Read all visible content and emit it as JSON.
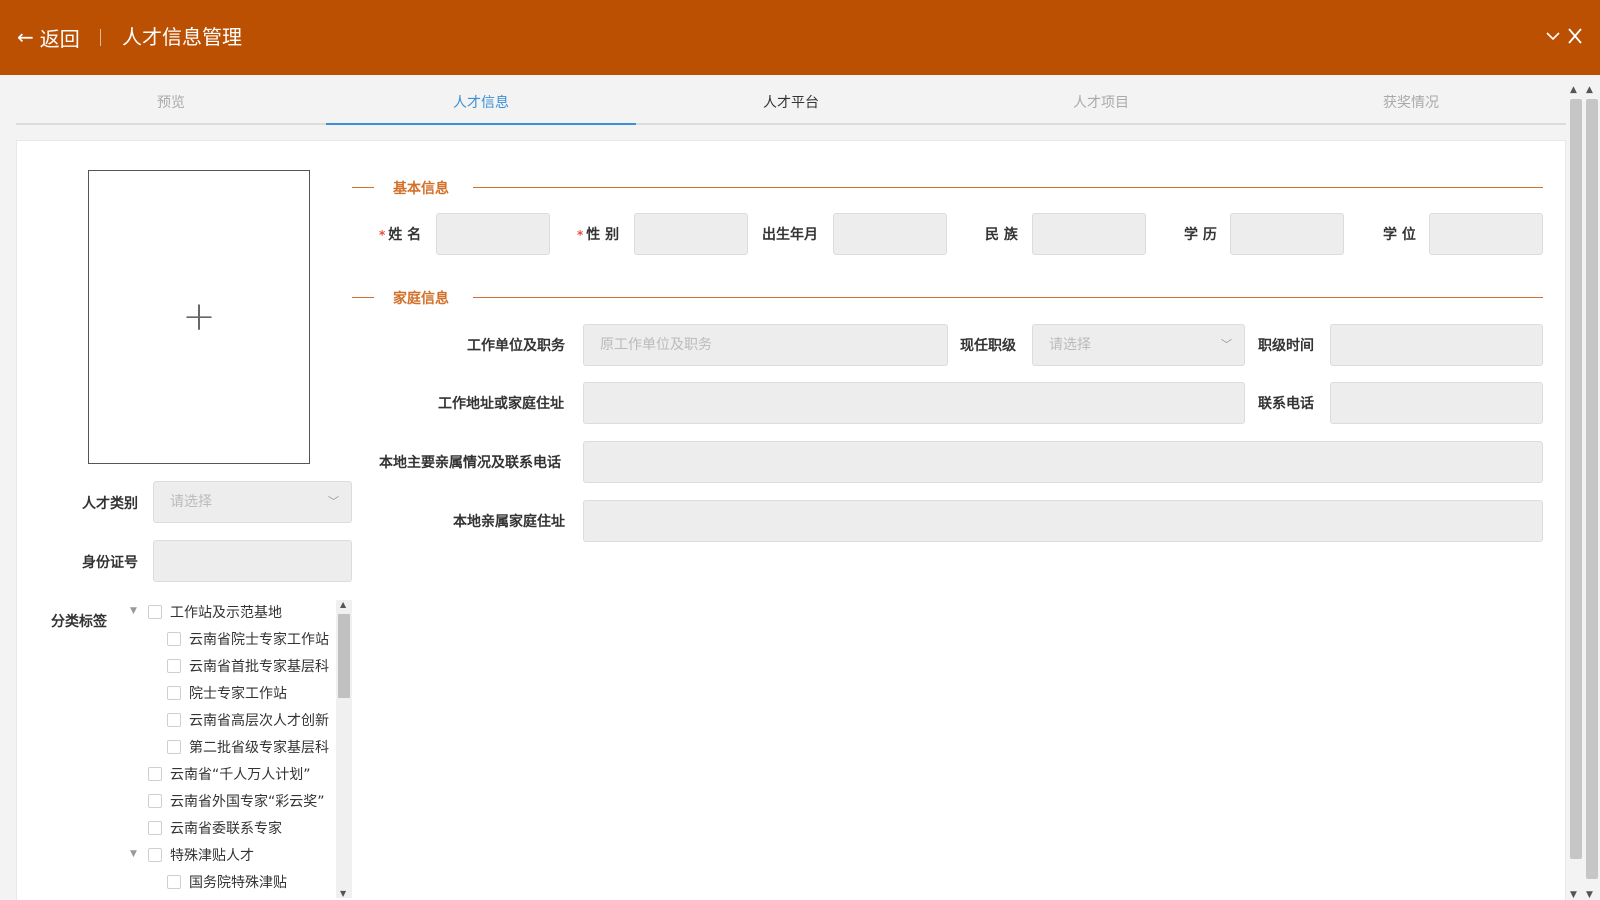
{
  "header": {
    "back_label": "返回",
    "title": "人才信息管理",
    "bg_color": "#bb5003"
  },
  "tabs": [
    {
      "label": "预览",
      "state": "disabled"
    },
    {
      "label": "人才信息",
      "state": "active"
    },
    {
      "label": "人才平台",
      "state": "normal"
    },
    {
      "label": "人才项目",
      "state": "disabled"
    },
    {
      "label": "获奖情况",
      "state": "disabled"
    }
  ],
  "left_panel": {
    "talent_category_label": "人才类别",
    "talent_category_placeholder": "请选择",
    "id_number_label": "身份证号",
    "tag_label": "分类标签"
  },
  "basic_info": {
    "title": "基本信息",
    "name_label": "姓 名",
    "gender_label": "性 别",
    "birth_label": "出生年月",
    "ethnicity_label": "民 族",
    "education_label": "学 历",
    "degree_label": "学 位",
    "required_mark": "*"
  },
  "family_info": {
    "title": "家庭信息",
    "work_unit_label": "工作单位及职务",
    "work_unit_placeholder": "原工作单位及职务",
    "current_rank_label": "现任职级",
    "current_rank_placeholder": "请选择",
    "rank_time_label": "职级时间",
    "address_label": "工作地址或家庭住址",
    "phone_label": "联系电话",
    "relatives_label": "本地主要亲属情况及联系电话",
    "relatives_address_label": "本地亲属家庭住址"
  },
  "tag_tree": [
    {
      "label": "工作站及示范基地",
      "level": 0,
      "expanded": true
    },
    {
      "label": "云南省院士专家工作站",
      "level": 1
    },
    {
      "label": "云南省首批专家基层科",
      "level": 1
    },
    {
      "label": "院士专家工作站",
      "level": 1
    },
    {
      "label": "云南省高层次人才创新",
      "level": 1
    },
    {
      "label": "第二批省级专家基层科",
      "level": 1
    },
    {
      "label": "云南省“千人万人计划”",
      "level": 0
    },
    {
      "label": "云南省外国专家“彩云奖”",
      "level": 0
    },
    {
      "label": "云南省委联系专家",
      "level": 0
    },
    {
      "label": "特殊津贴人才",
      "level": 0,
      "expanded": true
    },
    {
      "label": "国务院特殊津贴",
      "level": 1
    }
  ],
  "colors": {
    "accent": "#d2702a",
    "active_tab": "#3b8fd6"
  }
}
